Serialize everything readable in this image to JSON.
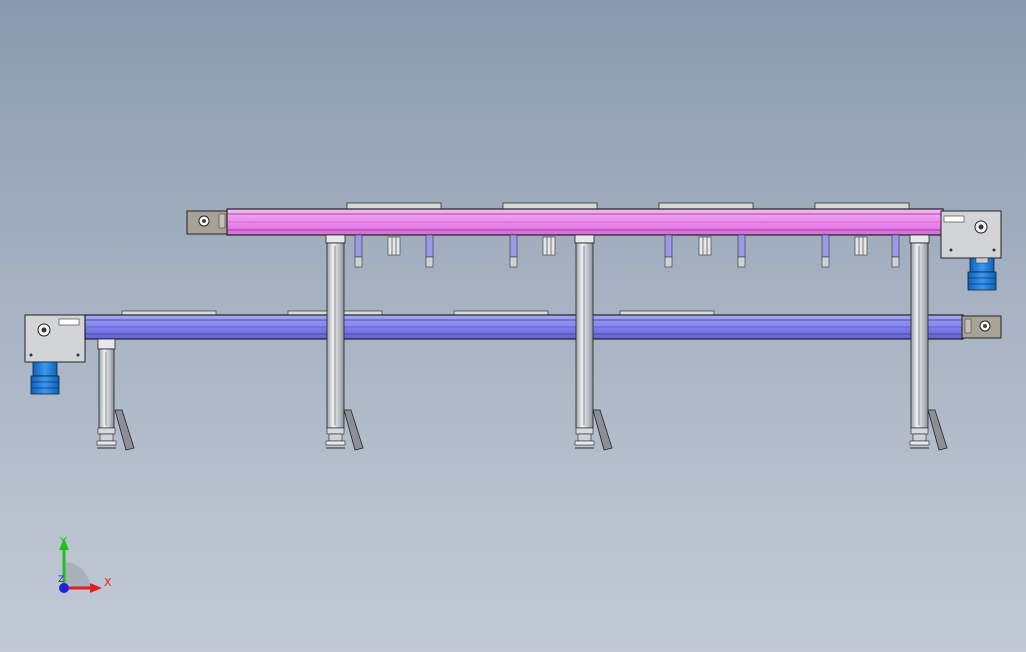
{
  "scene": {
    "kind": "CAD side view of twin belt conveyors",
    "upper_belt_color": "#ee88ee",
    "lower_belt_color": "#8080ee",
    "frame_color": "#c8ccd2",
    "motor_color": "#1e7ad8"
  },
  "triad": {
    "x_label": "X",
    "y_label": "Y",
    "z_label": "Z",
    "x_color": "#e02020",
    "y_color": "#20c020",
    "z_color": "#2020e0"
  }
}
